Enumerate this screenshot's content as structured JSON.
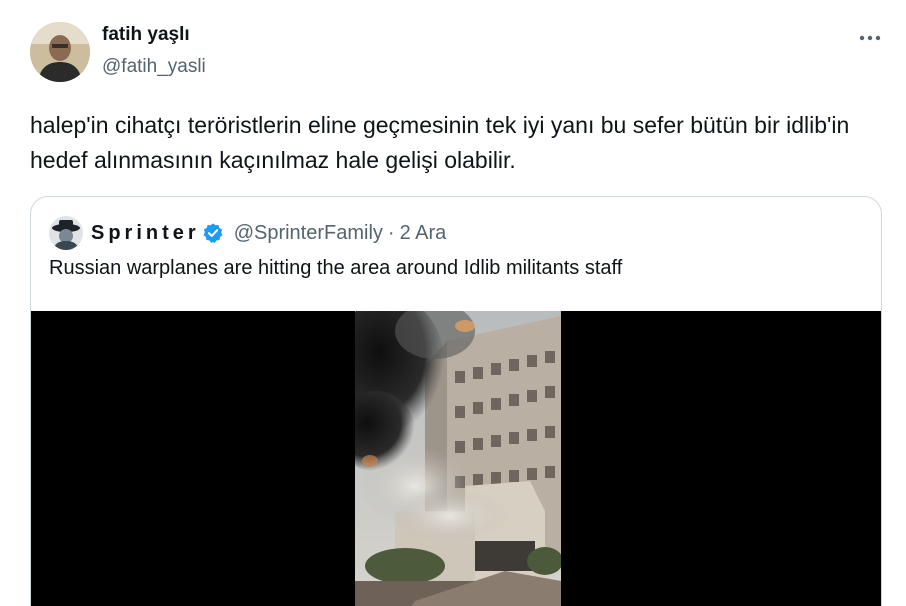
{
  "tweet": {
    "author_name": "fatih yaşlı",
    "author_handle": "@fatih_yasli",
    "more_label": "···",
    "text": "halep'in cihatçı teröristlerin eline geçmesinin tek iyi yanı bu sefer bütün bir idlib'in hedef alınmasının kaçınılmaz hale gelişi olabilir."
  },
  "quote": {
    "name": "Sprinter",
    "handle": "@SprinterFamily",
    "separator": "·",
    "date": "2 Ara",
    "text": "Russian warplanes are hitting the area around Idlib militants staff"
  },
  "colors": {
    "verified_badge": "#1d9bf0",
    "secondary_text": "#536471",
    "border": "#cfd9de"
  }
}
